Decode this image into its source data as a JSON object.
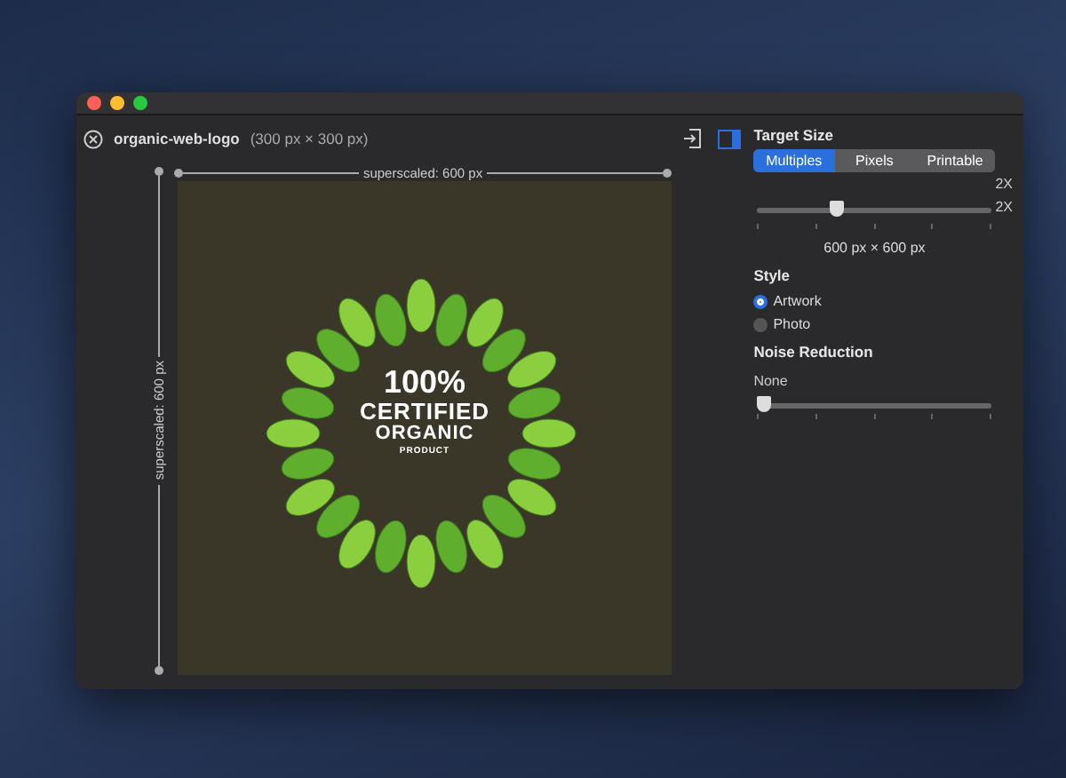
{
  "window": {
    "title_name": "organic-web-logo",
    "title_size": "(300 px × 300 px)"
  },
  "canvas": {
    "width_label": "superscaled: 600 px",
    "height_label": "superscaled: 600 px",
    "logo": {
      "line_1": "100%",
      "line_2": "CERTIFIED",
      "line_3": "ORGANIC",
      "line_4": "PRODUCT"
    }
  },
  "panel": {
    "target_size": {
      "heading": "Target Size",
      "tabs": [
        {
          "label": "Multiples",
          "selected": true
        },
        {
          "label": "Pixels",
          "selected": false
        },
        {
          "label": "Printable",
          "selected": false
        }
      ],
      "scale_labels": [
        "2X",
        "2X"
      ],
      "level": 0.34,
      "result": "600 px × 600 px"
    },
    "style": {
      "heading": "Style",
      "options": [
        {
          "label": "Artwork",
          "selected": true
        },
        {
          "label": "Photo",
          "selected": false
        }
      ]
    },
    "noise": {
      "heading": "Noise Reduction",
      "value": "None",
      "level": 0
    }
  }
}
